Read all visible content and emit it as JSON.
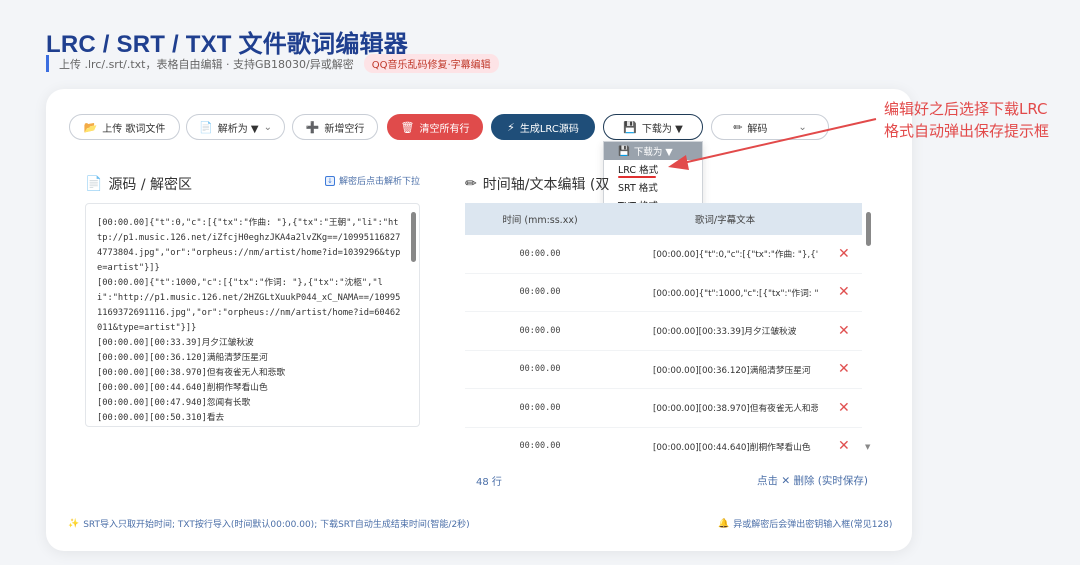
{
  "header": {
    "title": "LRC / SRT / TXT 文件歌词编辑器",
    "subtitle": "上传 .lrc/.srt/.txt，表格自由编辑 · 支持GB18030/异或解密",
    "badge": "QQ音乐乱码修复·字幕编辑"
  },
  "toolbar": {
    "upload": "上传 歌词文件",
    "parse_as": "解析为 ▼",
    "add_row": "新增空行",
    "clear_all": "清空所有行",
    "gen_lrc": "生成LRC源码",
    "download_as": "下载为 ▼",
    "decode": "解码"
  },
  "download_menu": {
    "header": "下载为 ▼",
    "items": [
      "LRC 格式",
      "SRT 格式",
      "TXT 格式"
    ]
  },
  "annotation": {
    "line1": "编辑好之后选择下载LRC",
    "line2": "格式自动弹出保存提示框"
  },
  "source_panel": {
    "title": "源码 / 解密区",
    "hint": "解密后点击解析下拉",
    "content": "[00:00.00]{\"t\":0,\"c\":[{\"tx\":\"作曲: \"},{\"tx\":\"王朝\",\"li\":\"http://p1.music.126.net/iZfcjH0eghzJKA4a2lvZKg==/109951168274773804.jpg\",\"or\":\"orpheus://nm/artist/home?id=1039296&type=artist\"}]}\n[00:00.00]{\"t\":1000,\"c\":[{\"tx\":\"作词: \"},{\"tx\":\"沈柩\",\"li\":\"http://p1.music.126.net/2HZGLtXuukP044_xC_NAMA==/109951169372691116.jpg\",\"or\":\"orpheus://nm/artist/home?id=60462011&type=artist\"}]}\n[00:00.00][00:33.39]月夕江皱秋波\n[00:00.00][00:36.120]满船清梦压星河\n[00:00.00][00:38.970]但有夜雀无人和悲歌\n[00:00.00][00:44.640]削桐作琴看山色\n[00:00.00][00:47.940]忽闻有长歌\n[00:00.00][00:50.310]看去"
  },
  "editor_panel": {
    "title": "时间轴/文本编辑 (双",
    "col_time": "时间 (mm:ss.xx)",
    "col_text": "歌词/字幕文本",
    "rows": [
      {
        "time": "00:00.00",
        "text": "[00:00.00]{\"t\":0,\"c\":[{\"tx\":\"作曲: \"},{\"tx\""
      },
      {
        "time": "00:00.00",
        "text": "[00:00.00]{\"t\":1000,\"c\":[{\"tx\":\"作词: \"},{"
      },
      {
        "time": "00:00.00",
        "text": "[00:00.00][00:33.39]月夕江皱秋波"
      },
      {
        "time": "00:00.00",
        "text": "[00:00.00][00:36.120]满船清梦压星河"
      },
      {
        "time": "00:00.00",
        "text": "[00:00.00][00:38.970]但有夜雀无人和悲"
      },
      {
        "time": "00:00.00",
        "text": "[00:00.00][00:44.640]削桐作琴看山色"
      }
    ],
    "row_count": "48 行",
    "delete_hint": "点击 ✕ 删除 (实时保存)"
  },
  "footer": {
    "left": "SRT导入只取开始时间; TXT按行导入(时间默认00:00.00); 下载SRT自动生成结束时间(智能/2秒)",
    "right": "异或解密后会弹出密钥输入框(常见128)"
  },
  "colors": {
    "accent": "#1f3f8f",
    "danger": "#e04b4b",
    "navy": "#1f4e79",
    "annotation": "#e24a4a"
  }
}
